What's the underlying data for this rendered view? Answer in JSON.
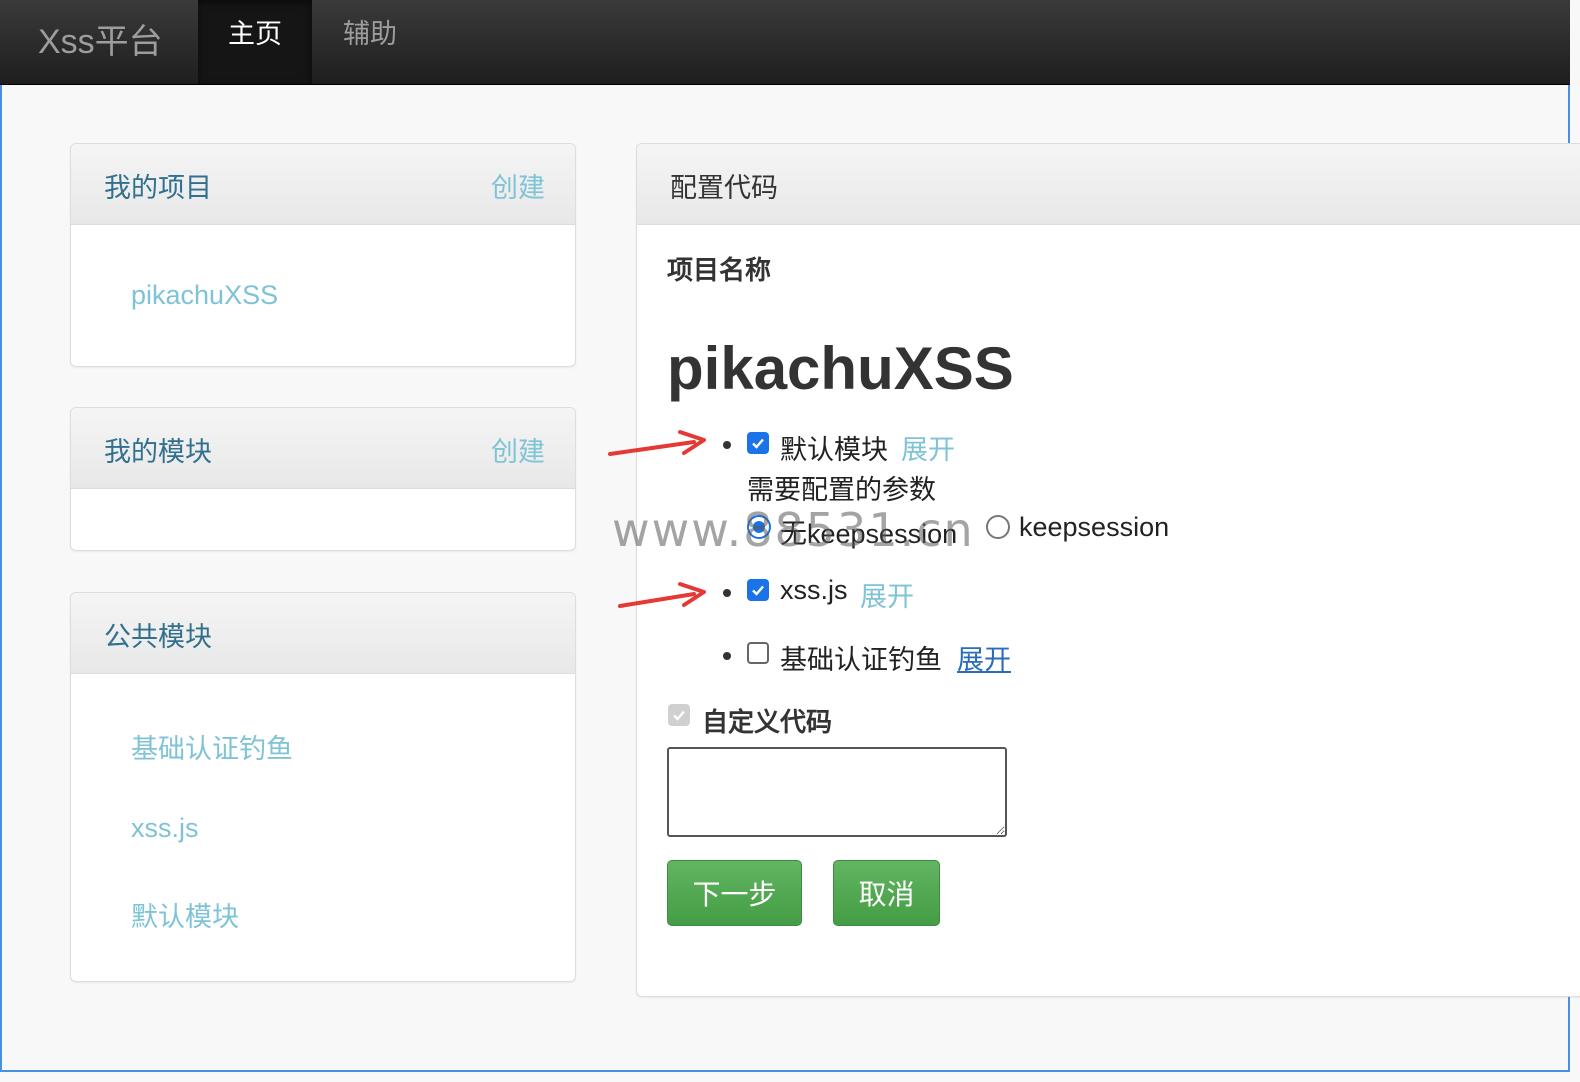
{
  "navbar": {
    "brand": "Xss平台",
    "items": [
      {
        "label": "主页",
        "active": true
      },
      {
        "label": "辅助",
        "active": false
      }
    ]
  },
  "sidebar": {
    "my_projects": {
      "title": "我的项目",
      "action": "创建",
      "items": [
        "pikachuXSS"
      ]
    },
    "my_modules": {
      "title": "我的模块",
      "action": "创建",
      "items": []
    },
    "public_modules": {
      "title": "公共模块",
      "items": [
        "基础认证钓鱼",
        "xss.js",
        "默认模块"
      ]
    }
  },
  "config": {
    "panel_title": "配置代码",
    "project_name_label": "项目名称",
    "project_name": "pikachuXSS",
    "modules": [
      {
        "name": "默认模块",
        "checked": true,
        "expand": "展开"
      },
      {
        "name": "xss.js",
        "checked": true,
        "expand": "展开"
      },
      {
        "name": "基础认证钓鱼",
        "checked": false,
        "expand": "展开"
      }
    ],
    "params_label": "需要配置的参数",
    "radio_options": [
      {
        "label": "无keepsession",
        "selected": true
      },
      {
        "label": "keepsession",
        "selected": false
      }
    ],
    "custom_code_label": "自定义代码",
    "custom_code_value": "",
    "next_button": "下一步",
    "cancel_button": "取消"
  },
  "watermark": "www.88531.cn",
  "colors": {
    "accent": "#1a73e8",
    "link": "#7fc3d6",
    "button_green": "#5cb85c",
    "annotation_arrow": "#e53935"
  }
}
